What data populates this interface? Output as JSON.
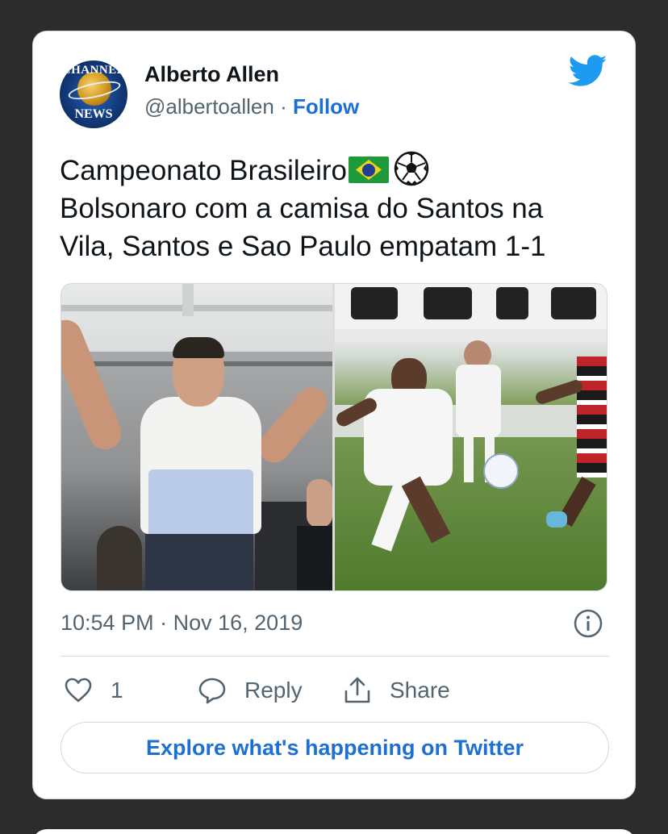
{
  "author": {
    "name": "Alberto Allen",
    "handle": "@albertoallen",
    "separator": "·",
    "follow_label": "Follow",
    "avatar_text_top": "CHANNEL",
    "avatar_text_bottom": "NEWS"
  },
  "tweet": {
    "line1": "Campeonato Brasileiro",
    "line2": "Bolsonaro com a camisa do Santos na",
    "line3": "Vila, Santos e Sao Paulo empatam 1-1",
    "emoji": [
      "brazil-flag",
      "soccer-ball"
    ]
  },
  "media": {
    "images": [
      {
        "icon": "photo-fan-in-stands"
      },
      {
        "icon": "photo-soccer-match"
      }
    ]
  },
  "meta": {
    "time": "10:54 PM",
    "date_separator": "·",
    "date": "Nov 16, 2019"
  },
  "actions": {
    "like_count": "1",
    "reply_label": "Reply",
    "share_label": "Share"
  },
  "explore_label": "Explore what's happening on Twitter",
  "colors": {
    "link": "#1d6fd2",
    "twitter_blue": "#1d9bf0",
    "muted": "#536471",
    "text": "#0f1419",
    "border": "#cfd9de",
    "backdrop": "#2c2c2c"
  }
}
